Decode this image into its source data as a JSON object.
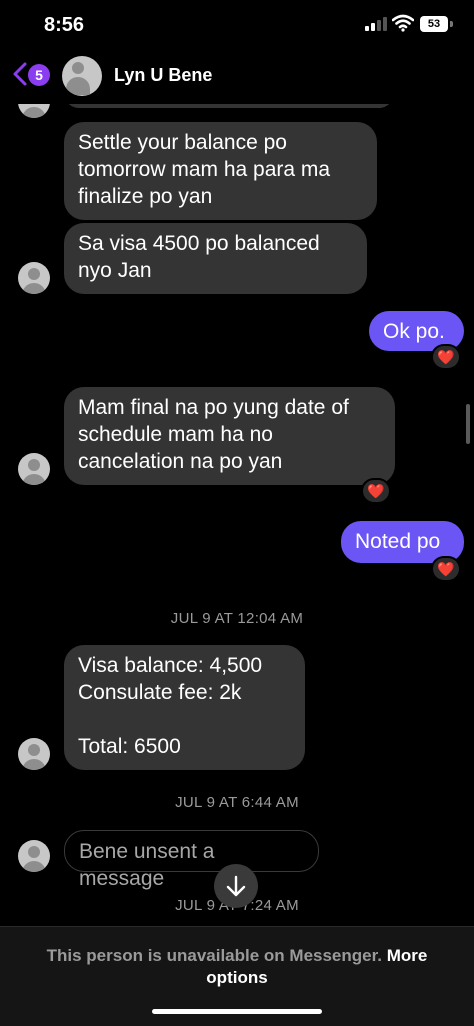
{
  "status_bar": {
    "time": "8:56",
    "battery": "53"
  },
  "header": {
    "back_badge": "5",
    "contact_name": "Lyn U Bene"
  },
  "messages": [
    {
      "text": "Settle your balance po\ntomorrow mam ha para ma\nfinalize po yan"
    },
    {
      "text": "Sa visa 4500 po balanced\nnyo Jan"
    },
    {
      "text": "Ok po.",
      "reaction": "❤️"
    },
    {
      "text": "Mam final na po yung date of\nschedule mam ha no\ncancelation na po yan",
      "reaction": "❤️"
    },
    {
      "text": "Noted po",
      "reaction": "❤️"
    },
    {
      "text": "Visa balance: 4,500\nConsulate fee: 2k\n\nTotal: 6500"
    },
    {
      "text": "Bene unsent a message"
    }
  ],
  "timestamps": [
    "JUL 9 AT 12:04 AM",
    "JUL 9 AT 6:44 AM",
    "JUL 9 AT 7:24 AM"
  ],
  "footer": {
    "text": "This person is unavailable on Messenger.",
    "link": "More options"
  },
  "colors": {
    "sent_bubble": "#6b56f5",
    "received_bubble": "#343434",
    "badge": "#8b3df0"
  }
}
